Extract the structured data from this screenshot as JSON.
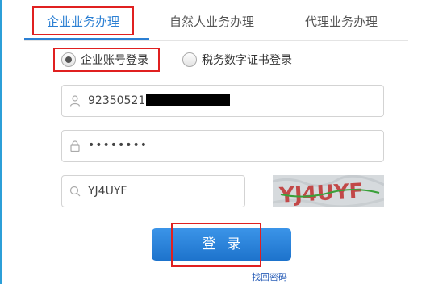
{
  "tabs": [
    {
      "label": "企业业务办理",
      "active": true
    },
    {
      "label": "自然人业务办理",
      "active": false
    },
    {
      "label": "代理业务办理",
      "active": false
    }
  ],
  "login_methods": [
    {
      "label": "企业账号登录",
      "selected": true
    },
    {
      "label": "税务数字证书登录",
      "selected": false
    }
  ],
  "form": {
    "account": {
      "icon": "user-icon",
      "value_visible": "92350521",
      "value_redacted": true
    },
    "password": {
      "icon": "lock-icon",
      "value": "••••••••"
    },
    "captcha": {
      "icon": "search-icon",
      "value": "YJ4UYF",
      "image_text": "YJ4UYF"
    }
  },
  "login_button": {
    "label": "登录"
  },
  "forgot_link": {
    "label": "找回密码"
  },
  "colors": {
    "accent": "#2b7fd3",
    "highlight_box": "#e02020",
    "button": "#1d73cc"
  }
}
